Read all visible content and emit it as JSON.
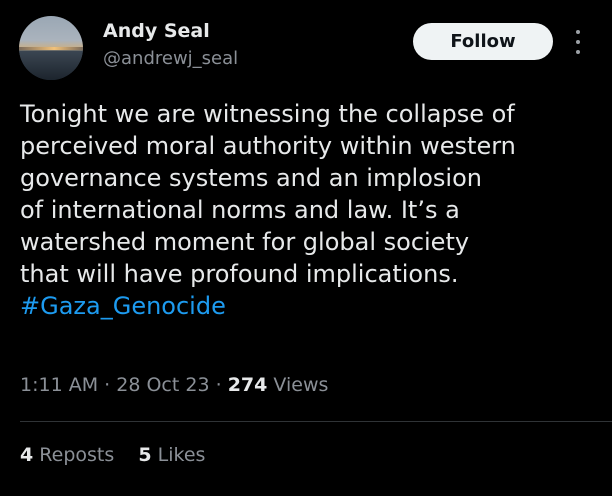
{
  "author": {
    "name": "Andy Seal",
    "handle": "@andrewj_seal",
    "follow_label": "Follow"
  },
  "tweet": {
    "lines": [
      "Tonight we are witnessing the collapse of",
      "perceived moral authority within western",
      "governance systems and an implosion",
      "of international norms and law. It’s a",
      "watershed moment for global society",
      "that will have profound implications."
    ],
    "hashtag": "#Gaza_Genocide"
  },
  "meta": {
    "time": "1:11 AM",
    "date": "28 Oct 23",
    "views_count": "274",
    "views_label": "Views",
    "separator": "·"
  },
  "stats": {
    "reposts_count": "4",
    "reposts_label": "Reposts",
    "likes_count": "5",
    "likes_label": "Likes"
  },
  "colors": {
    "background": "#000000",
    "text": "#e7e9ea",
    "secondary": "#8b9097",
    "link": "#1d9bf0",
    "button_bg": "#eff3f4"
  },
  "icons": {
    "more": "more-vertical-icon"
  }
}
